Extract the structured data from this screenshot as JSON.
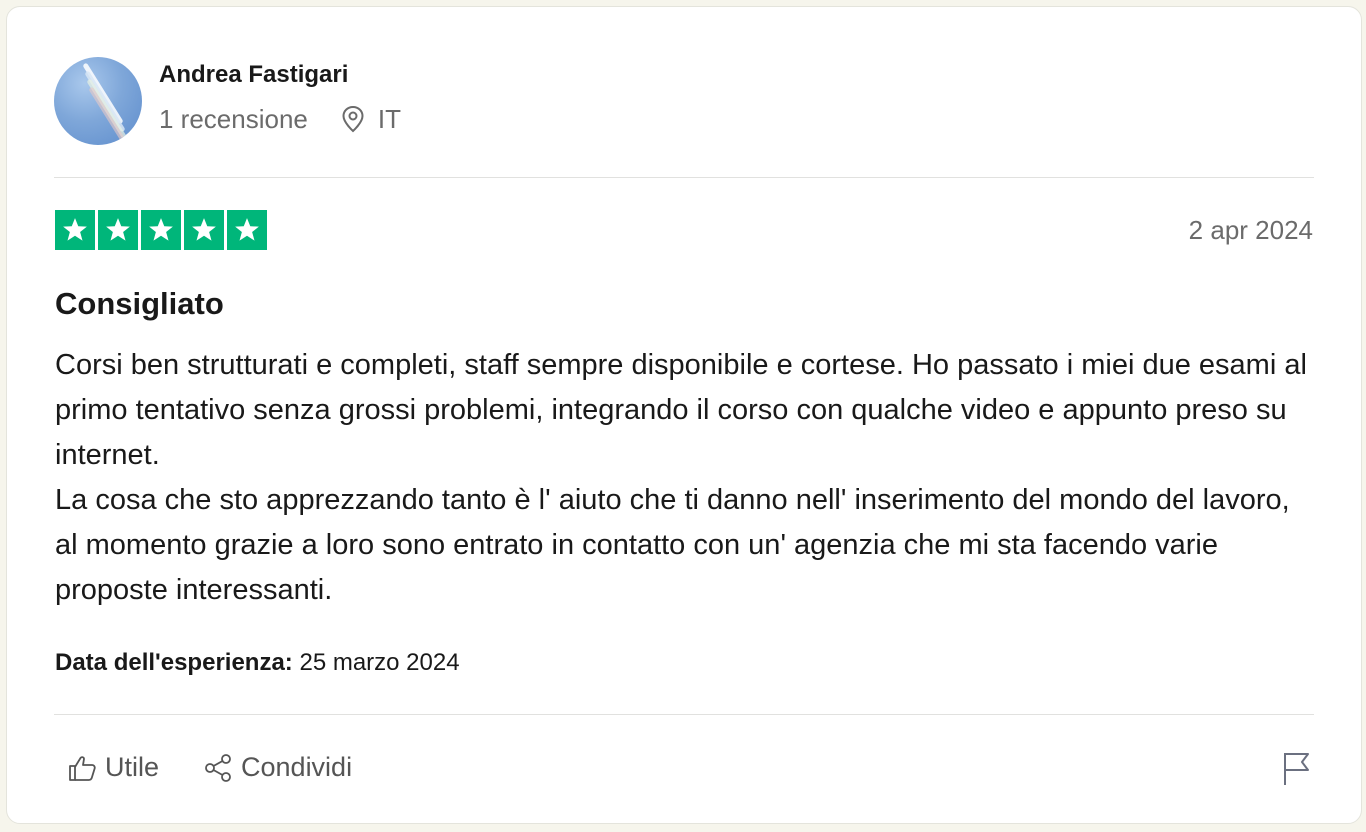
{
  "reviewer": {
    "name": "Andrea Fastigari",
    "review_count": "1 recensione",
    "country": "IT",
    "avatar_icon": "avatar-photo",
    "location_icon": "location-pin-icon"
  },
  "review": {
    "rating": 5,
    "rating_max": 5,
    "date": "2 apr 2024",
    "title": "Consigliato",
    "body": [
      "Corsi ben strutturati e completi, staff sempre disponibile e cortese. Ho passato i miei due esami al primo tentativo senza grossi problemi, integrando il corso con qualche video e appunto preso su internet.",
      "La cosa che sto apprezzando tanto è l' aiuto che ti danno nell' inserimento del mondo del lavoro, al momento grazie a loro sono entrato in contatto con un' agenzia che mi sta facendo varie proposte interessanti."
    ],
    "experience_label": "Data dell'esperienza:",
    "experience_date": "25 marzo 2024"
  },
  "actions": {
    "useful_label": "Utile",
    "useful_icon": "thumbs-up-icon",
    "share_label": "Condividi",
    "share_icon": "share-icon",
    "flag_icon": "flag-icon"
  },
  "colors": {
    "star_green": "#00b67a",
    "muted_text": "#6b6b6b",
    "text": "#191919",
    "page_background": "#f6f5ec"
  }
}
